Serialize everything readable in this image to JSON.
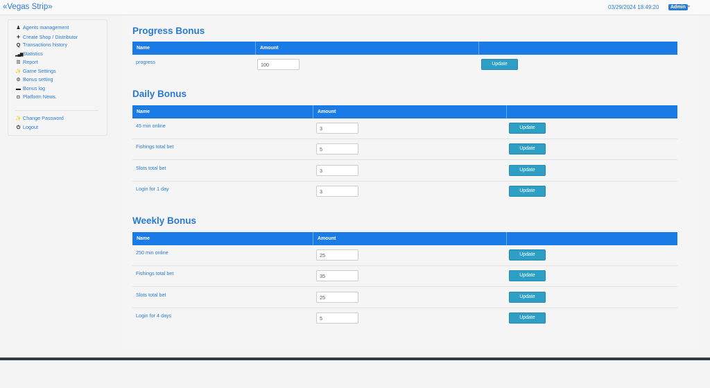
{
  "header": {
    "brand": "«Vegas Strip»",
    "datetime": "03/29/2024 18:49:20",
    "user": "Admin",
    "caret": "▾"
  },
  "sidebar": {
    "items": [
      {
        "label": "Agents management",
        "icon": "user-icon",
        "glyph": "👤"
      },
      {
        "label": "Create Shop / Distributor",
        "icon": "plus-icon",
        "glyph": "+"
      },
      {
        "label": "Transactions history",
        "icon": "search-icon",
        "glyph": "🔍"
      },
      {
        "label": "Statistics",
        "icon": "signal-icon",
        "glyph": "▁▃▅"
      },
      {
        "label": "Report",
        "icon": "list-icon",
        "glyph": "☰"
      },
      {
        "label": "Game Settings",
        "icon": "wrench-icon",
        "glyph": "🔧"
      },
      {
        "label": "Bonus setting",
        "icon": "gear-icon",
        "glyph": "⚙"
      },
      {
        "label": "Bonus log",
        "icon": "inbox-icon",
        "glyph": "▬"
      },
      {
        "label": "Platform News.",
        "icon": "camera-icon",
        "glyph": "◘"
      }
    ],
    "account": [
      {
        "label": "Change Password",
        "icon": "wrench-icon",
        "glyph": "🔧"
      },
      {
        "label": "Logout",
        "icon": "power-icon",
        "glyph": "⏻"
      }
    ]
  },
  "progress": {
    "title": "Progress Bonus",
    "col_name": "Name",
    "col_amount": "Amount",
    "rows": [
      {
        "name": "progress",
        "amount": "100",
        "button": "Update"
      }
    ]
  },
  "daily": {
    "title": "Daily Bonus",
    "col_name": "Name",
    "col_amount": "Amount",
    "rows": [
      {
        "name": "45 min online",
        "amount": "3",
        "button": "Update"
      },
      {
        "name": "Fishings total bet",
        "amount": "5",
        "button": "Update"
      },
      {
        "name": "Slots total bet",
        "amount": "3",
        "button": "Update"
      },
      {
        "name": "Login for 1 day",
        "amount": "3",
        "button": "Update"
      }
    ]
  },
  "weekly": {
    "title": "Weekly Bonus",
    "col_name": "Name",
    "col_amount": "Amount",
    "rows": [
      {
        "name": "250 min online",
        "amount": "25",
        "button": "Update"
      },
      {
        "name": "Fishings total bet",
        "amount": "35",
        "button": "Update"
      },
      {
        "name": "Slots total bet",
        "amount": "25",
        "button": "Update"
      },
      {
        "name": "Login for 4 days",
        "amount": "5",
        "button": "Update"
      }
    ]
  }
}
